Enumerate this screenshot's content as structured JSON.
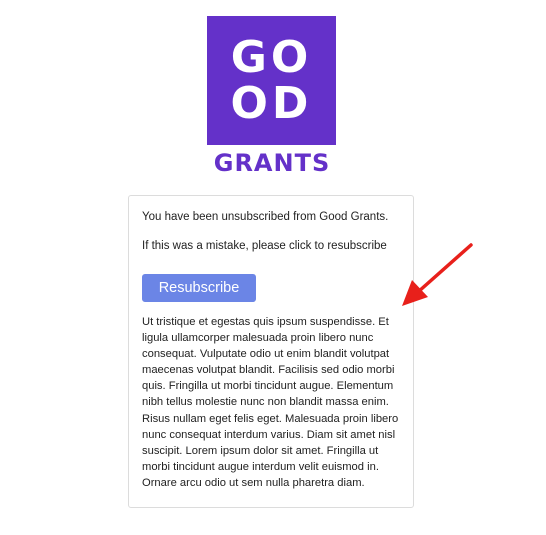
{
  "logo": {
    "line1": "GO",
    "line2": "OD",
    "word": "GRANTS",
    "brand_color": "#6431c9"
  },
  "card": {
    "unsubscribed_message": "You have been unsubscribed from Good Grants.",
    "mistake_message": "If this was a mistake, please click to resubscribe",
    "resubscribe_label": "Resubscribe",
    "button_color": "#6b85e6",
    "body_text": "Ut tristique et egestas quis ipsum suspendisse. Et ligula ullamcorper malesuada proin libero nunc consequat. Vulputate odio ut enim blandit volutpat maecenas volutpat blandit. Facilisis sed odio morbi quis. Fringilla ut morbi tincidunt augue. Elementum nibh tellus molestie nunc non blandit massa enim. Risus nullam eget felis eget. Malesuada proin libero nunc consequat interdum varius. Diam sit amet nisl suscipit. Lorem ipsum dolor sit amet. Fringilla ut morbi tincidunt augue interdum velit euismod in. Ornare arcu odio ut sem nulla pharetra diam."
  },
  "annotation": {
    "arrow_icon": "red-arrow-icon",
    "arrow_color": "#e8201b"
  }
}
